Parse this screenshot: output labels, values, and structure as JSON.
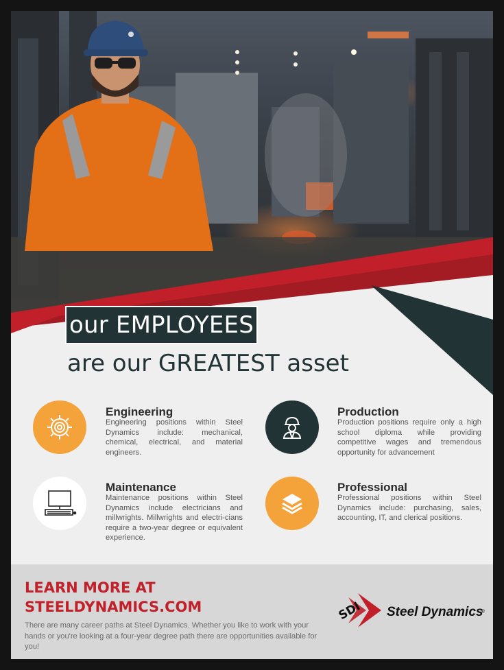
{
  "headline": {
    "line1": "our EMPLOYEES",
    "line2": "are our GREATEST asset"
  },
  "positions": [
    {
      "title": "Engineering",
      "icon": "gear-icon",
      "text": "Engineering positions within Steel Dynamics include: mechanical, chemical, electrical, and material engineers."
    },
    {
      "title": "Production",
      "icon": "worker-icon",
      "text": "Production positions require only a high school diploma while providing competitive wages and tremendous opportunity for advancement"
    },
    {
      "title": "Maintenance",
      "icon": "computer-icon",
      "text": "Maintenance positions within Steel Dynamics include electricians and millwrights. Millwrights and electri-cians require a two-year degree or equivalent experience."
    },
    {
      "title": "Professional",
      "icon": "layers-icon",
      "text": "Professional positions within Steel Dynamics include: purchasing, sales, accounting, IT, and clerical positions."
    }
  ],
  "footer": {
    "learn_line1": "LEARN MORE AT",
    "learn_line2": "STEELDYNAMICS.COM",
    "blurb": "There are many career paths at Steel Dynamics. Whether you like to work with your hands or you're looking at a four-year degree path there are opportunities available for you!"
  },
  "logo": {
    "mark": "SDI",
    "name": "Steel Dynamics",
    "registered": "®"
  },
  "colors": {
    "brand_red": "#c1202a",
    "dark_teal": "#223335",
    "orange": "#f4a23a",
    "page_bg": "#efefef"
  }
}
